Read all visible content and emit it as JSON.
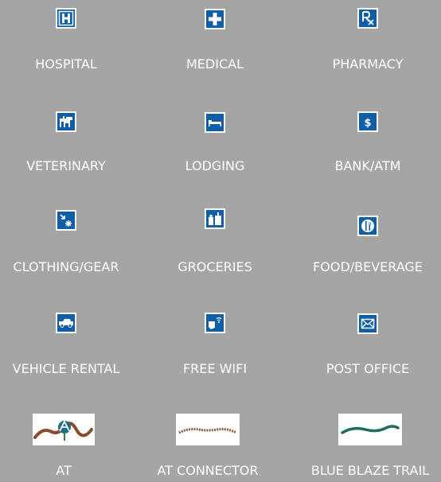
{
  "legend": {
    "items": [
      {
        "label": "HOSPITAL",
        "icon": "hospital-icon"
      },
      {
        "label": "MEDICAL",
        "icon": "medical-cross-icon"
      },
      {
        "label": "PHARMACY",
        "icon": "pharmacy-rx-icon"
      },
      {
        "label": "VETERINARY",
        "icon": "veterinary-icon"
      },
      {
        "label": "LODGING",
        "icon": "lodging-bed-icon"
      },
      {
        "label": "BANK/ATM",
        "icon": "bank-dollar-icon"
      },
      {
        "label": "CLOTHING/GEAR",
        "icon": "clothing-gear-icon"
      },
      {
        "label": "GROCERIES",
        "icon": "groceries-icon"
      },
      {
        "label": "FOOD/BEVERAGE",
        "icon": "food-beverage-icon"
      },
      {
        "label": "VEHICLE RENTAL",
        "icon": "vehicle-rental-icon"
      },
      {
        "label": "FREE WIFI",
        "icon": "free-wifi-icon"
      },
      {
        "label": "POST OFFICE",
        "icon": "post-office-envelope-icon"
      },
      {
        "label": "AT",
        "icon": "appalachian-trail-icon"
      },
      {
        "label": "AT CONNECTOR",
        "icon": "at-connector-trail-icon"
      },
      {
        "label": "BLUE BLAZE TRAIL",
        "icon": "blue-blaze-trail-icon"
      }
    ]
  },
  "colors": {
    "background": "#a5a5a5",
    "sign_blue": "#0f5ea8",
    "label_text": "#ffffff",
    "at_trail": "#8b4a2b",
    "connector_trail": "#8b5a3c",
    "blue_blaze_trail": "#1f6b5e"
  }
}
